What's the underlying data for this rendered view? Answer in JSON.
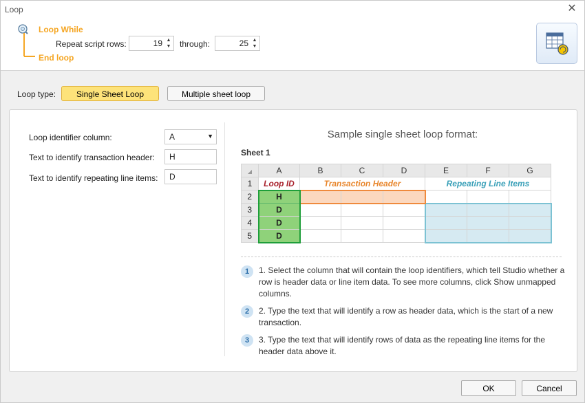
{
  "window": {
    "title": "Loop",
    "close_glyph": "✕"
  },
  "loop_header": {
    "loop_while": "Loop While",
    "end_loop": "End loop",
    "repeat_label": "Repeat script rows:",
    "from_value": "19",
    "through_label": "through:",
    "through_value": "25"
  },
  "loop_type": {
    "label": "Loop type:",
    "single": "Single Sheet Loop",
    "multiple": "Multiple sheet loop",
    "active": "single"
  },
  "fields": {
    "identifier_label": "Loop identifier column:",
    "identifier_value": "A",
    "header_label": "Text to identify transaction header:",
    "header_value": "H",
    "line_label": "Text to identify repeating line items:",
    "line_value": "D"
  },
  "sample": {
    "title": "Sample single sheet loop format:",
    "sheet_label": "Sheet 1",
    "columns": [
      "A",
      "B",
      "C",
      "D",
      "E",
      "F",
      "G"
    ],
    "rows": [
      "1",
      "2",
      "3",
      "4",
      "5"
    ],
    "loop_id_label": "Loop ID",
    "transaction_header_label": "Transaction Header",
    "repeating_items_label": "Repeating Line Items",
    "ids": [
      "H",
      "D",
      "D",
      "D"
    ]
  },
  "steps": [
    {
      "num": "1",
      "text": "1. Select the column that will contain the loop identifiers, which tell Studio whether a row is header data or line item data. To see more columns, click Show unmapped columns."
    },
    {
      "num": "2",
      "text": "2. Type the text that will identify a row as header data, which is the start of a new transaction."
    },
    {
      "num": "3",
      "text": "3. Type the text that will identify rows of data as the repeating line items for the header data above it."
    }
  ],
  "buttons": {
    "ok": "OK",
    "cancel": "Cancel"
  },
  "colors": {
    "accent_orange": "#f5a623",
    "loop_id_green": "#8fd27a",
    "loop_id_border": "#1e9e3a",
    "header_orange_fill": "#fbd8bf",
    "header_orange_border": "#ef8a3d",
    "line_items_fill": "#d6eaf2",
    "line_items_border": "#7cc2d3",
    "loop_id_text": "#a8202a",
    "transaction_text": "#e8862c",
    "repeating_text": "#3aa0b8",
    "active_tab": "#fde37a"
  },
  "icons": {
    "close": "close-icon",
    "loop_diagram": "loop-diagram-icon",
    "spinner": "spinner-arrows-icon",
    "dropdown": "chevron-down-icon",
    "corner": "sheet-loop-icon"
  }
}
